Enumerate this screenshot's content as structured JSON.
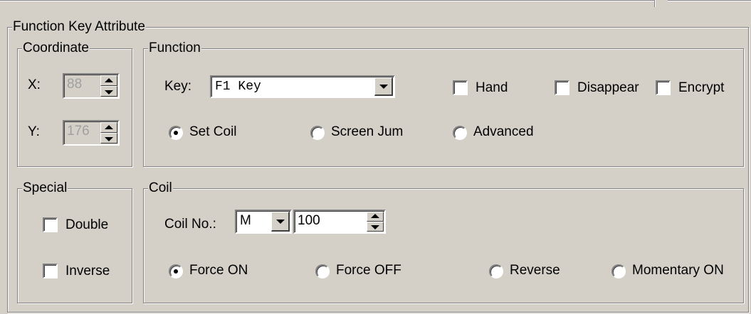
{
  "panel_title": "Function Key Attribute",
  "coordinate": {
    "title": "Coordinate",
    "x_label": "X:",
    "x_value": "88",
    "y_label": "Y:",
    "y_value": "176"
  },
  "function": {
    "title": "Function",
    "key_label": "Key:",
    "key_value": "F1 Key",
    "hand_label": "Hand",
    "disappear_label": "Disappear",
    "encrypt_label": "Encrypt",
    "set_coil_label": "Set Coil",
    "screen_jump_label": "Screen Jum",
    "advanced_label": "Advanced",
    "selected": "Set Coil"
  },
  "special": {
    "title": "Special",
    "double_label": "Double",
    "inverse_label": "Inverse"
  },
  "coil": {
    "title": "Coil",
    "coil_no_label": "Coil No.:",
    "device_type": "M",
    "coil_number": "100",
    "force_on_label": "Force ON",
    "force_off_label": "Force OFF",
    "reverse_label": "Reverse",
    "momentary_on_label": "Momentary ON",
    "selected": "Force ON"
  },
  "icons": {
    "spin": "up-down-arrow-icon",
    "dropdown": "chevron-down-icon"
  }
}
